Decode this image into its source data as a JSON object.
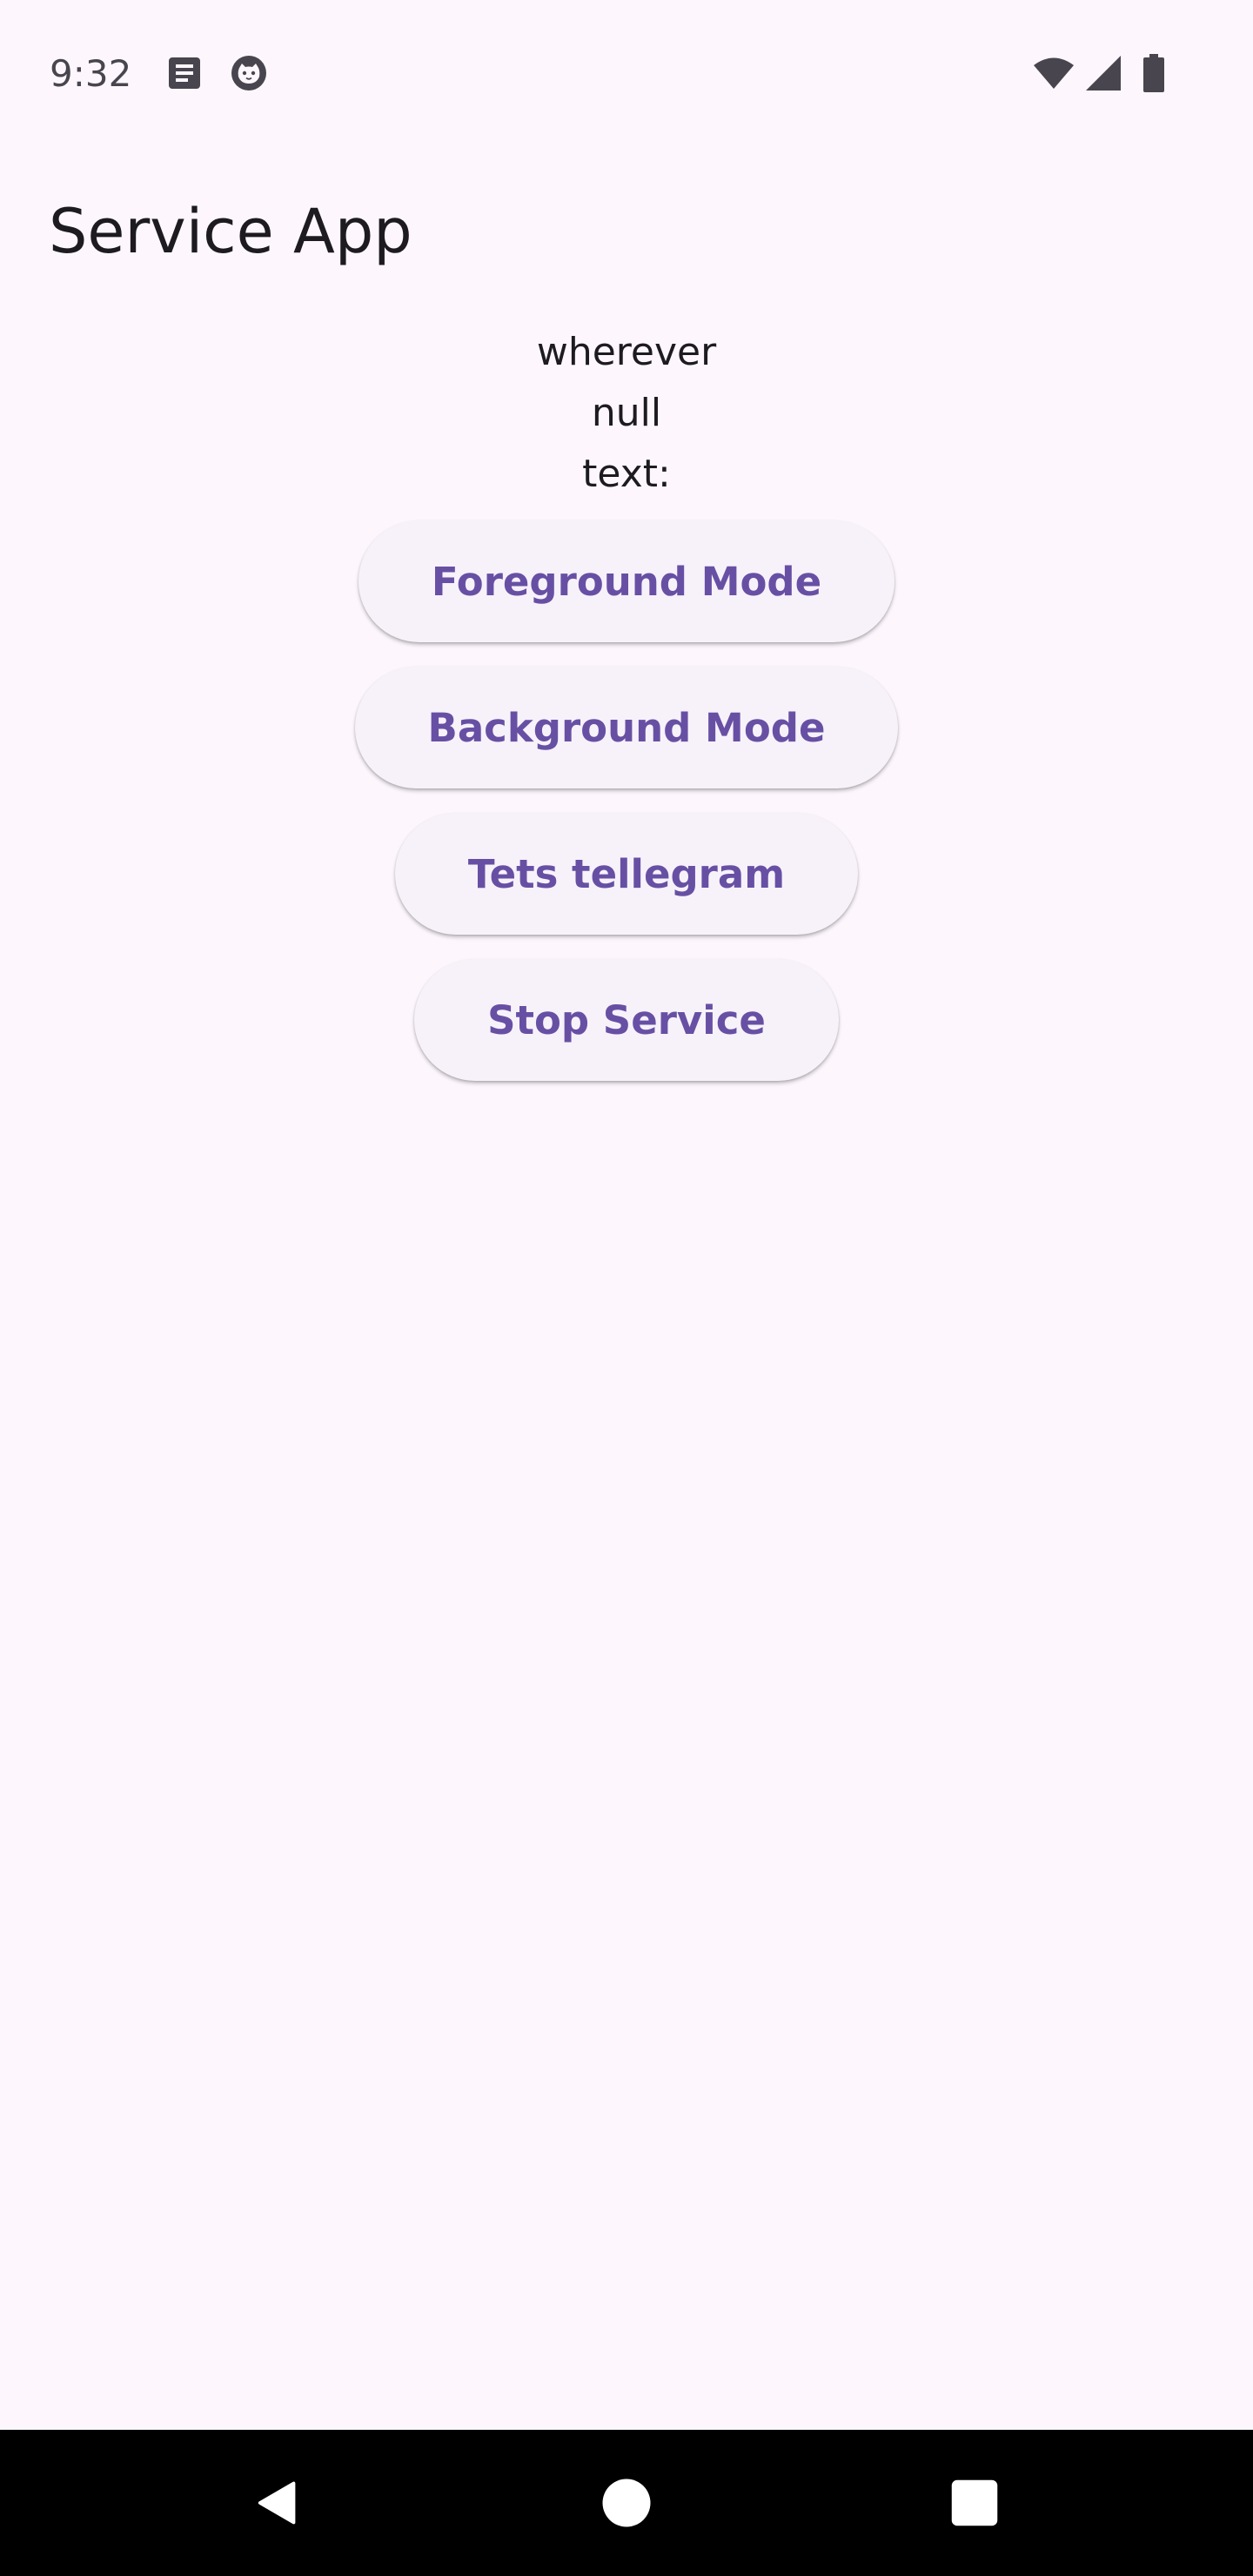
{
  "status_bar": {
    "time": "9:32",
    "icons": [
      "notes-icon",
      "cat-face-icon",
      "wifi-icon",
      "cell-signal-icon",
      "battery-icon"
    ]
  },
  "app_bar": {
    "title": "Service App"
  },
  "content": {
    "lines": [
      "wherever",
      "null",
      "text:"
    ],
    "buttons": [
      {
        "label": "Foreground Mode"
      },
      {
        "label": "Background Mode"
      },
      {
        "label": "Tets tellegram"
      },
      {
        "label": "Stop Service"
      }
    ]
  },
  "navigation_bar": {
    "icons": [
      "back-icon",
      "home-icon",
      "recents-icon"
    ]
  },
  "colors": {
    "background": "#fdf7fd",
    "button_background": "#f7f2fa",
    "button_text": "#6750a4",
    "primary_text": "#1d1b20",
    "status_text": "#49454f",
    "nav_bar": "#000000"
  }
}
